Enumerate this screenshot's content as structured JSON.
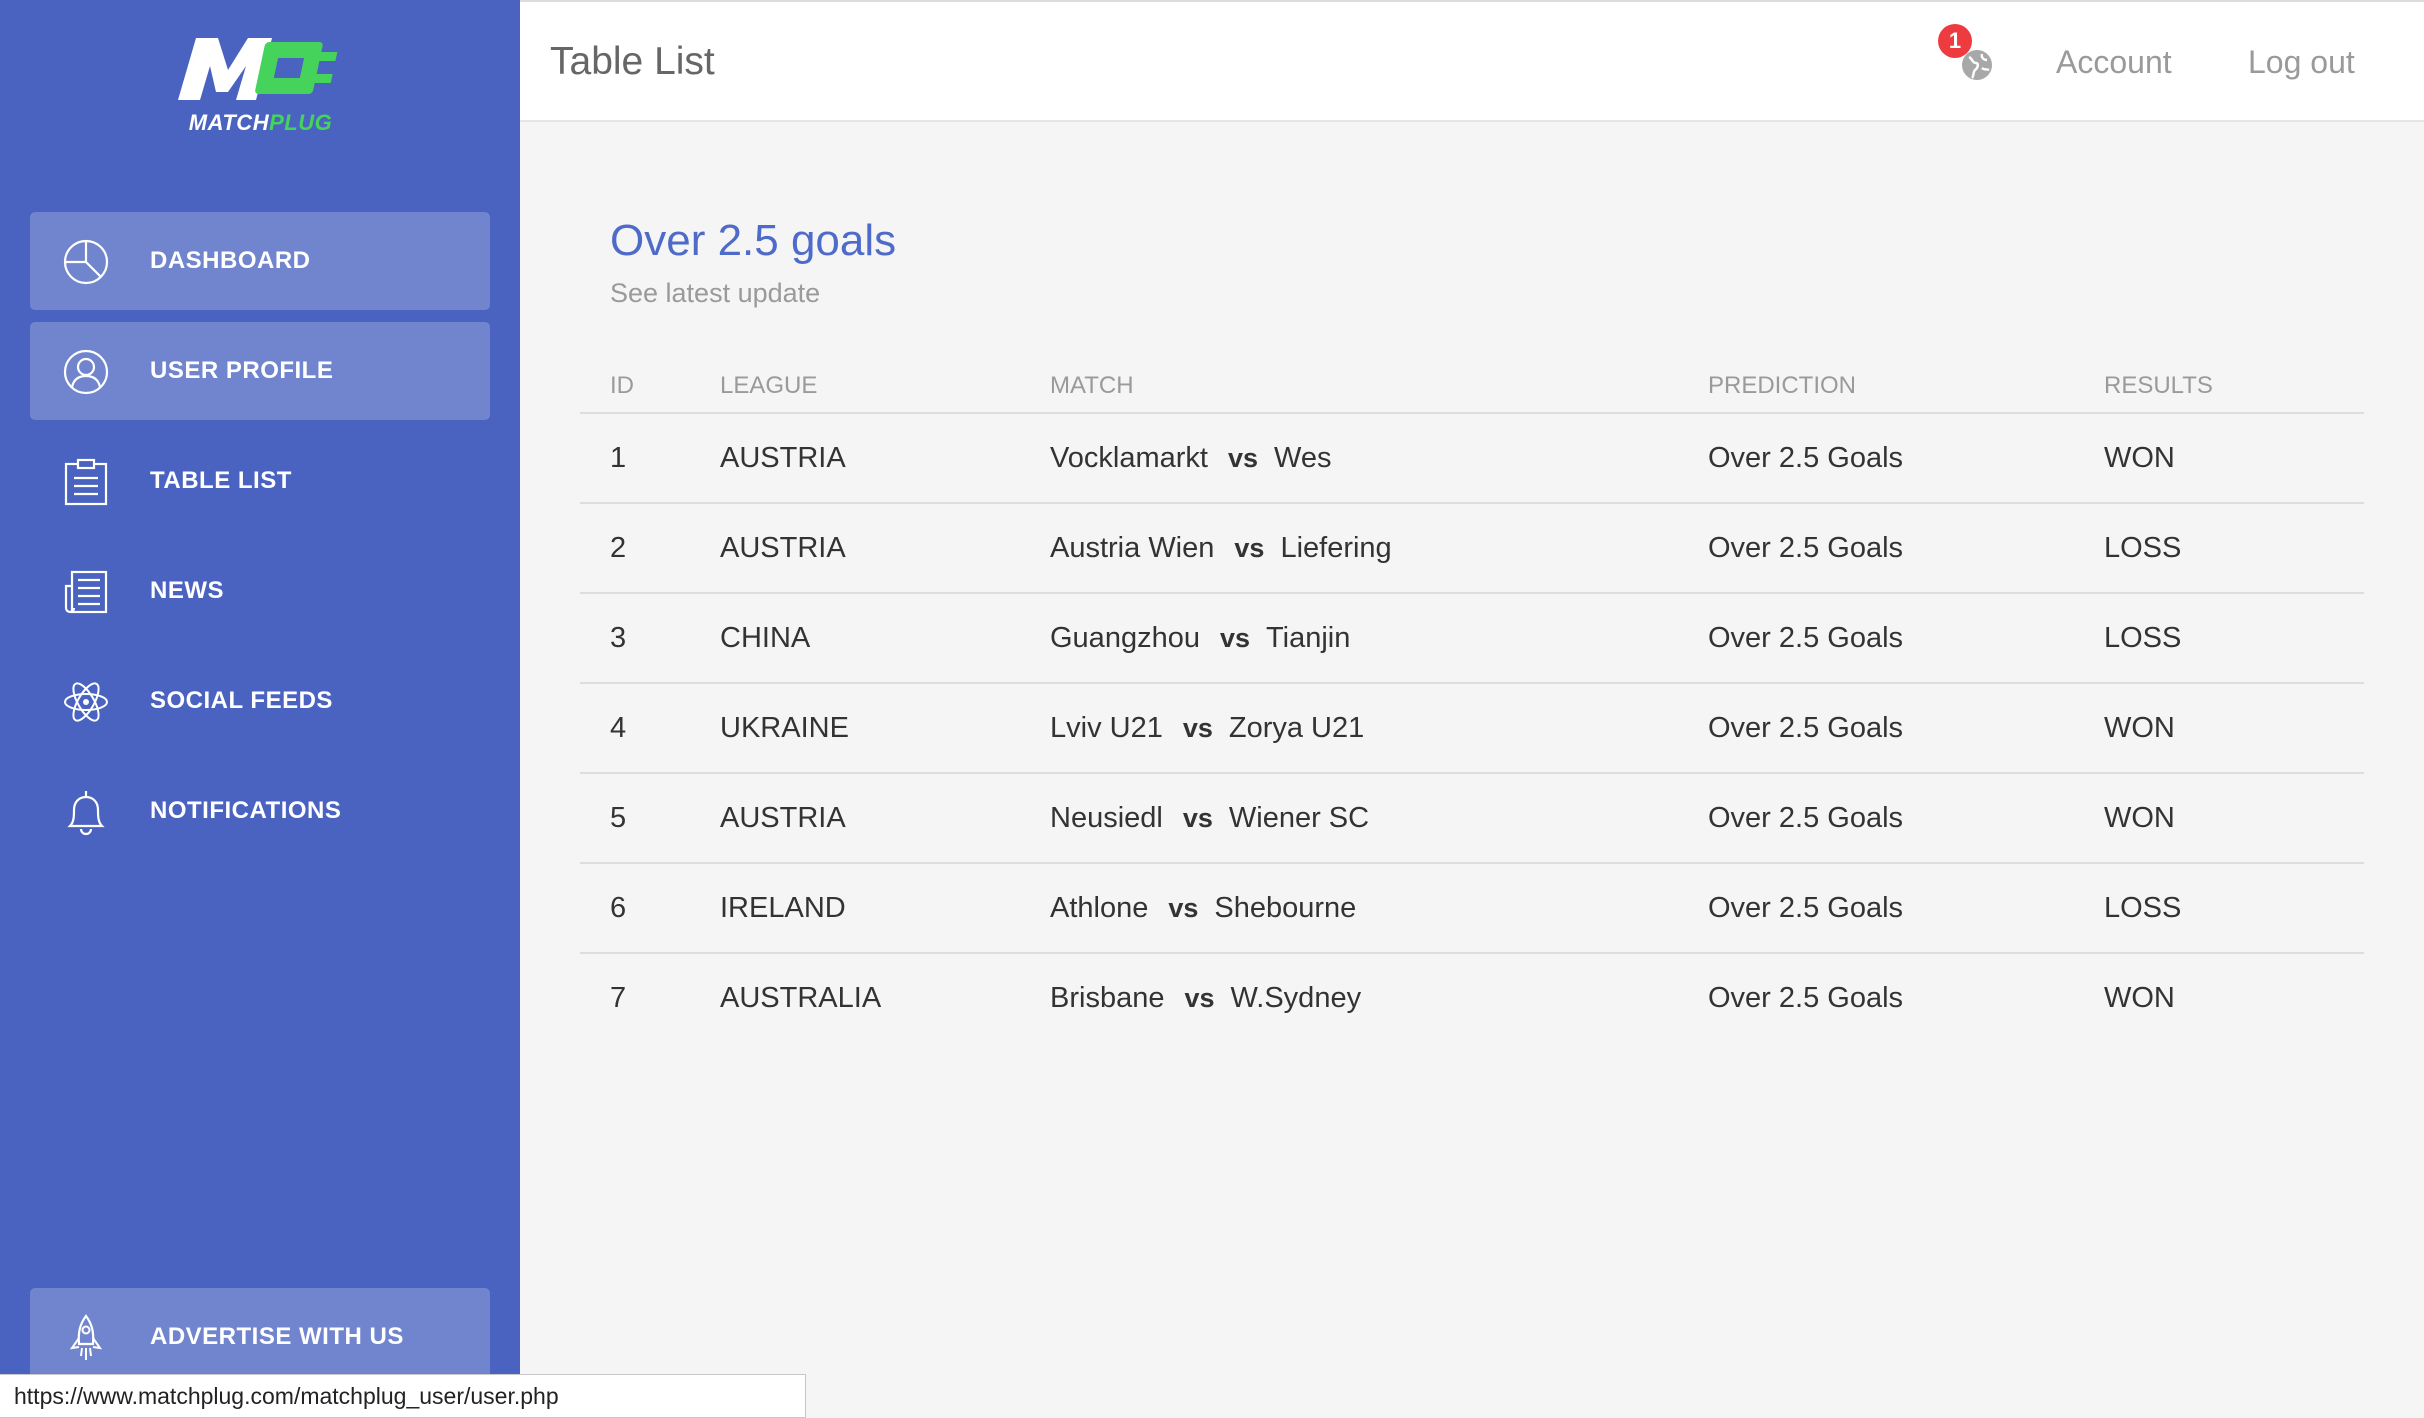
{
  "brand": {
    "logo_word_main": "MATCH",
    "logo_word_accent": "PLUG",
    "green": "#46d35b",
    "sidebar_color": "#4a63c0",
    "accent_text": "#4f6bc9"
  },
  "sidebar": {
    "items": [
      {
        "label": "DASHBOARD",
        "icon": "pie-chart-icon"
      },
      {
        "label": "USER PROFILE",
        "icon": "user-icon"
      },
      {
        "label": "TABLE LIST",
        "icon": "clipboard-list-icon"
      },
      {
        "label": "NEWS",
        "icon": "newspaper-icon"
      },
      {
        "label": "SOCIAL FEEDS",
        "icon": "atom-icon"
      },
      {
        "label": "NOTIFICATIONS",
        "icon": "bell-icon"
      }
    ],
    "advertise": {
      "label": "ADVERTISE WITH US",
      "icon": "rocket-icon"
    }
  },
  "header": {
    "title": "Table List",
    "notification_count": "1",
    "account_label": "Account",
    "logout_label": "Log out"
  },
  "main": {
    "title": "Over 2.5 goals",
    "subtitle": "See latest update",
    "columns": [
      "ID",
      "LEAGUE",
      "MATCH",
      "PREDICTION",
      "RESULTS"
    ],
    "vs_label": "vs",
    "rows": [
      {
        "id": "1",
        "league": "AUSTRIA",
        "home": "Vocklamarkt",
        "away": "Wes",
        "prediction": "Over 2.5 Goals",
        "result": "WON"
      },
      {
        "id": "2",
        "league": "AUSTRIA",
        "home": "Austria Wien",
        "away": "Liefering",
        "prediction": "Over 2.5 Goals",
        "result": "LOSS"
      },
      {
        "id": "3",
        "league": "CHINA",
        "home": "Guangzhou",
        "away": "Tianjin",
        "prediction": "Over 2.5 Goals",
        "result": "LOSS"
      },
      {
        "id": "4",
        "league": "UKRAINE",
        "home": "Lviv U21",
        "away": "Zorya U21",
        "prediction": "Over 2.5 Goals",
        "result": "WON"
      },
      {
        "id": "5",
        "league": "AUSTRIA",
        "home": "Neusiedl",
        "away": "Wiener SC",
        "prediction": "Over 2.5 Goals",
        "result": "WON"
      },
      {
        "id": "6",
        "league": "IRELAND",
        "home": "Athlone",
        "away": "Shebourne",
        "prediction": "Over 2.5 Goals",
        "result": "LOSS"
      },
      {
        "id": "7",
        "league": "AUSTRALIA",
        "home": "Brisbane",
        "away": "W.Sydney",
        "prediction": "Over 2.5 Goals",
        "result": "WON"
      }
    ]
  },
  "statusbar": {
    "url": "https://www.matchplug.com/matchplug_user/user.php"
  }
}
